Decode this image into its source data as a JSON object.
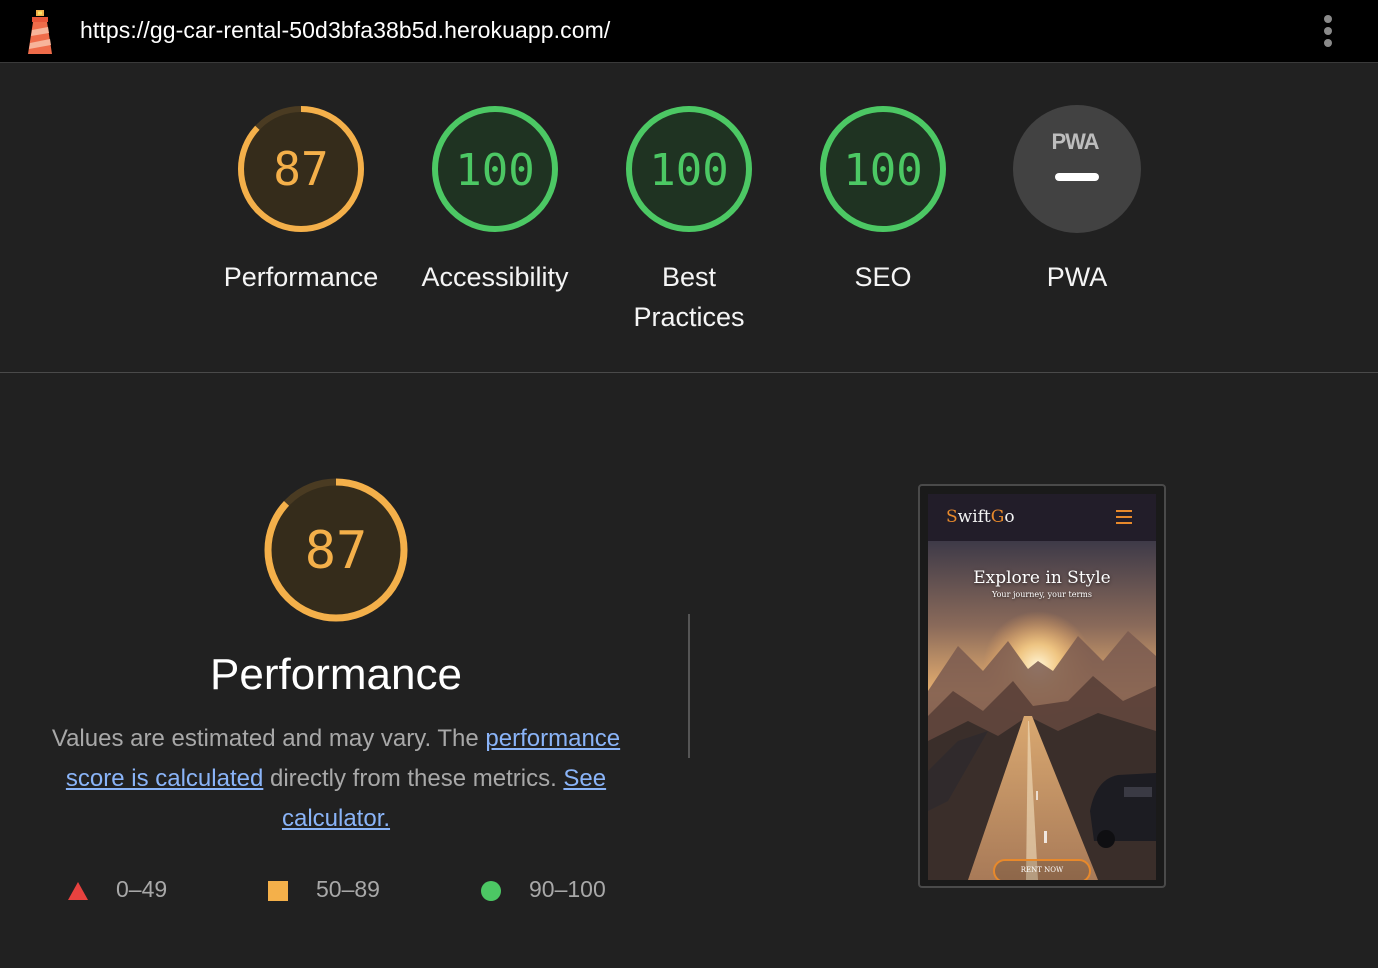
{
  "address_bar": {
    "url": "https://gg-car-rental-50d3bfa38b5d.herokuapp.com/"
  },
  "colors": {
    "average": "#f4b04a",
    "pass": "#4cc864",
    "fail": "#e8423f",
    "link": "#8ab4f8",
    "pwa_bg": "#424242"
  },
  "gauges": [
    {
      "label": "Performance",
      "score": "87",
      "value": 0.87,
      "rating": "average"
    },
    {
      "label": "Accessibility",
      "score": "100",
      "value": 1.0,
      "rating": "pass"
    },
    {
      "label_line1": "Best",
      "label_line2": "Practices",
      "score": "100",
      "value": 1.0,
      "rating": "pass"
    },
    {
      "label": "SEO",
      "score": "100",
      "value": 1.0,
      "rating": "pass"
    },
    {
      "label": "PWA",
      "badge": "PWA",
      "icon": "pwa-dash-icon"
    }
  ],
  "performance": {
    "score": "87",
    "value": 0.87,
    "title": "Performance",
    "desc_prefix": "Values are estimated and may vary. The ",
    "link_score": "performance score is calculated",
    "desc_middle": " directly from these metrics. ",
    "link_calc": "See calculator.",
    "legend": [
      {
        "range": "0–49",
        "icon": "triangle-icon"
      },
      {
        "range": "50–89",
        "icon": "square-icon"
      },
      {
        "range": "90–100",
        "icon": "circle-icon"
      }
    ]
  },
  "screenshot": {
    "brand_first": "S",
    "brand_rest": "wift",
    "brand_accent": "G",
    "brand_end": "o",
    "hero_title": "Explore in Style",
    "hero_subtitle": "Your journey, your terms",
    "cta": "RENT NOW"
  }
}
